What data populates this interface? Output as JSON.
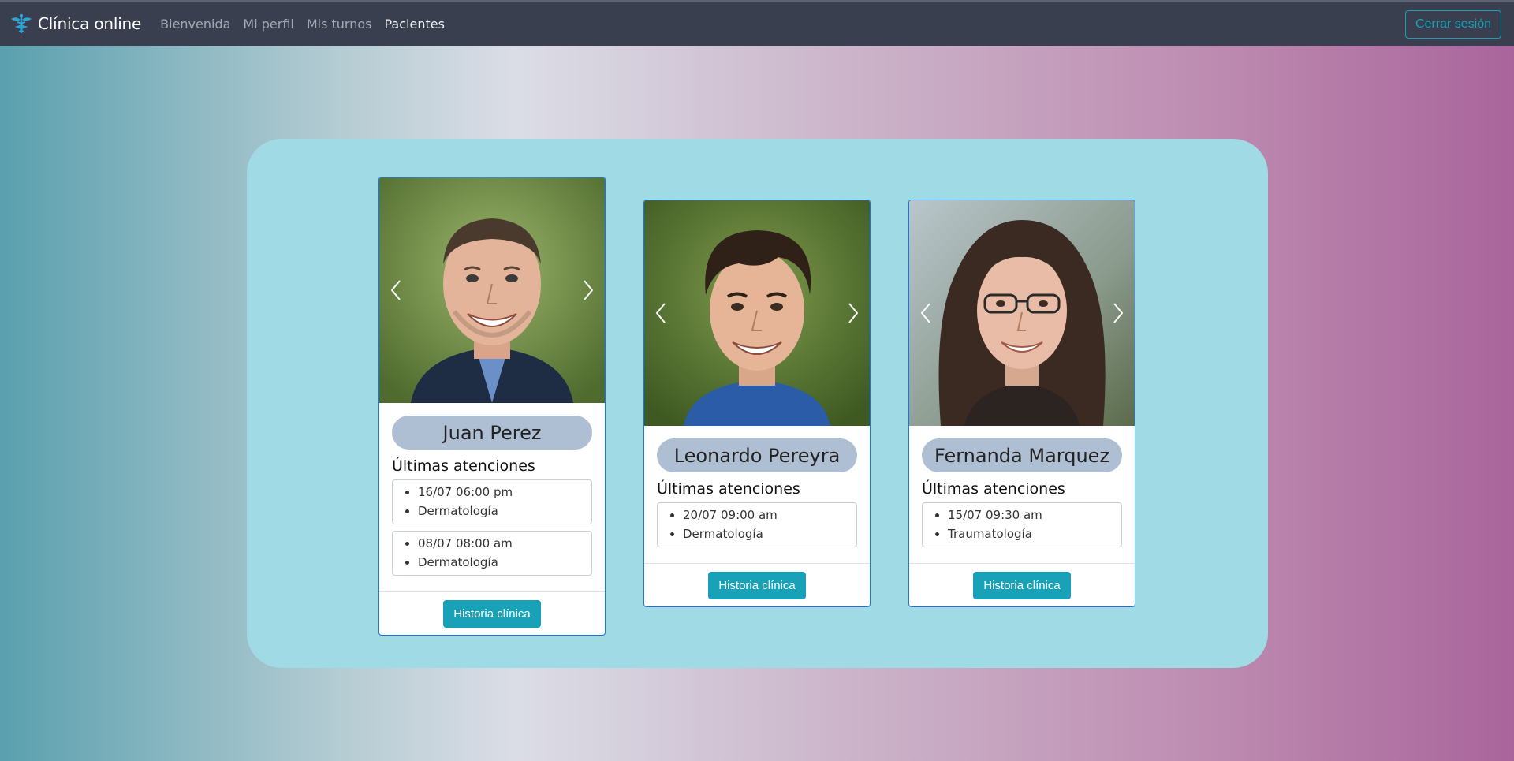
{
  "navbar": {
    "brand": "Clínica online",
    "links": [
      "Bienvenida",
      "Mi perfil",
      "Mis turnos",
      "Pacientes"
    ],
    "active_link": "Pacientes",
    "logout_label": "Cerrar sesión"
  },
  "section_title": "Últimas atenciones",
  "button_label": "Historia clínica",
  "patients": [
    {
      "name": "Juan Perez",
      "appointments": [
        {
          "datetime": "16/07 06:00 pm",
          "specialty": "Dermatología"
        },
        {
          "datetime": "08/07 08:00 am",
          "specialty": "Dermatología"
        }
      ]
    },
    {
      "name": "Leonardo Pereyra",
      "appointments": [
        {
          "datetime": "20/07 09:00 am",
          "specialty": "Dermatología"
        }
      ]
    },
    {
      "name": "Fernanda Marquez",
      "appointments": [
        {
          "datetime": "15/07 09:30 am",
          "specialty": "Traumatología"
        }
      ]
    }
  ],
  "colors": {
    "accent": "#17a2b8",
    "navbar": "#393f4e",
    "panel": "#a0dbe5",
    "name_pill": "#aebfd3",
    "card_border": "#1a73e8"
  },
  "icons": {
    "brand": "caduceus-icon",
    "prev": "chevron-left-icon",
    "next": "chevron-right-icon"
  }
}
